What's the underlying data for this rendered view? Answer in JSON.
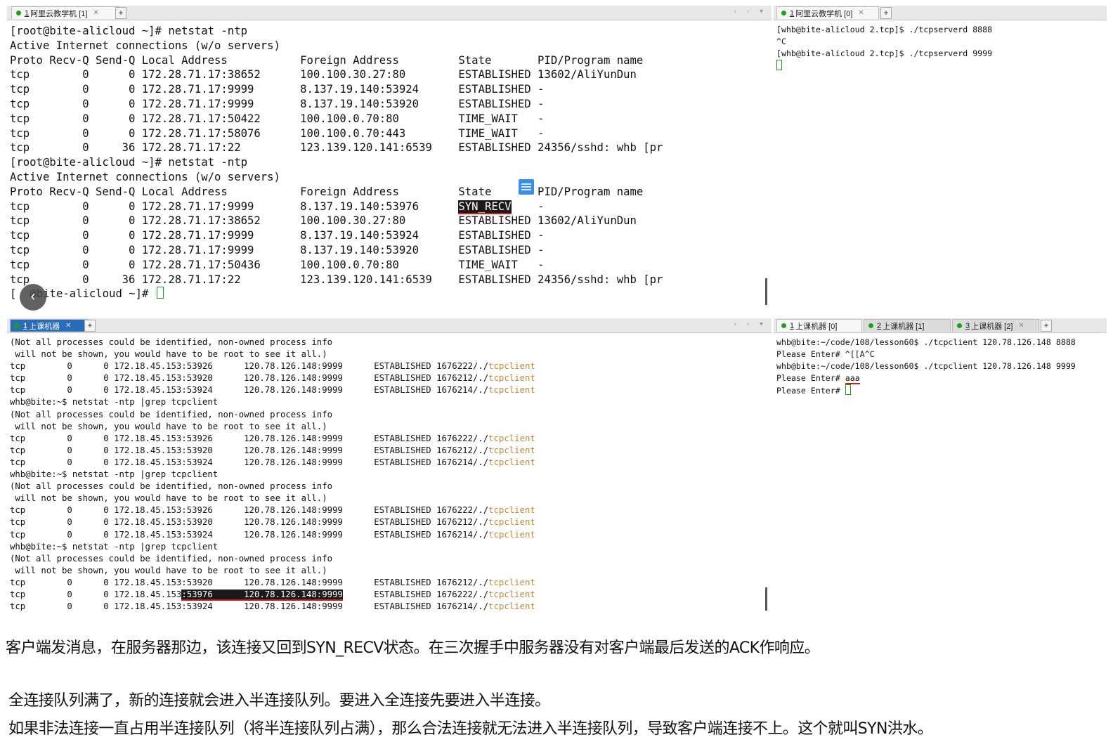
{
  "top_left": {
    "tab": {
      "index": "1",
      "label": "阿里云教学机 [1]"
    },
    "lines": [
      "[root@bite-alicloud ~]# netstat -ntp",
      "Active Internet connections (w/o servers)",
      "Proto Recv-Q Send-Q Local Address           Foreign Address         State       PID/Program name",
      "tcp        0      0 172.28.71.17:38652      100.100.30.27:80        ESTABLISHED 13602/AliYunDun",
      "tcp        0      0 172.28.71.17:9999       8.137.19.140:53924      ESTABLISHED -",
      "tcp        0      0 172.28.71.17:9999       8.137.19.140:53920      ESTABLISHED -",
      "tcp        0      0 172.28.71.17:50422      100.100.0.70:80         TIME_WAIT   -",
      "tcp        0      0 172.28.71.17:58076      100.100.0.70:443        TIME_WAIT   -",
      "tcp        0     36 172.28.71.17:22         123.139.120.141:6539    ESTABLISHED 24356/sshd: whb [pr",
      "[root@bite-alicloud ~]# netstat -ntp",
      "Active Internet connections (w/o servers)",
      "Proto Recv-Q Send-Q Local Address           Foreign Address         State       PID/Program name"
    ],
    "syn_row": {
      "pre": "tcp        0      0 172.28.71.17:9999       8.137.19.140:53976      ",
      "state": "SYN_RECV",
      "post": "    -"
    },
    "lines2": [
      "tcp        0      0 172.28.71.17:38652      100.100.30.27:80        ESTABLISHED 13602/AliYunDun",
      "tcp        0      0 172.28.71.17:9999       8.137.19.140:53924      ESTABLISHED -",
      "tcp        0      0 172.28.71.17:9999       8.137.19.140:53920      ESTABLISHED -",
      "tcp        0      0 172.28.71.17:50436      100.100.0.70:80         TIME_WAIT   -",
      "tcp        0     36 172.28.71.17:22         123.139.120.141:6539    ESTABLISHED 24356/sshd: whb [pr"
    ],
    "prompt_pre": "[",
    "prompt_post": "@bite-alicloud ~]# "
  },
  "top_right": {
    "tab": {
      "index": "1",
      "label": "阿里云教学机 [0]"
    },
    "lines": [
      "[whb@bite-alicloud 2.tcp]$ ./tcpserverd 8888",
      "^C",
      "[whb@bite-alicloud 2.tcp]$ ./tcpserverd 9999"
    ]
  },
  "bottom_left": {
    "tab": {
      "index": "1",
      "label": "上课机器"
    },
    "note1": "(Not all processes could be identified, non-owned process info",
    "note2": " will not be shown, you would have to be root to see it all.)",
    "cmd": "whb@bite:~$ netstat -ntp |grep tcpclient",
    "prog_prefix": "/./",
    "prog": "tcpclient",
    "rows_a": [
      {
        "pre": "tcp        0      0 172.18.45.153:53926      120.78.126.148:9999      ESTABLISHED 1676222"
      },
      {
        "pre": "tcp        0      0 172.18.45.153:53920      120.78.126.148:9999      ESTABLISHED 1676212"
      },
      {
        "pre": "tcp        0      0 172.18.45.153:53924      120.78.126.148:9999      ESTABLISHED 1676214"
      }
    ],
    "last_rows": {
      "r1": "tcp        0      0 172.18.45.153:53920      120.78.126.148:9999      ESTABLISHED 1676212",
      "r2_pre": "tcp        0      0 172.18.45.153",
      "r2_hl": ":53976      120.78.126.148:9999",
      "r2_post": "      ESTABLISHED 1676222",
      "r3": "tcp        0      0 172.18.45.153:53924      120.78.126.148:9999      ESTABLISHED 1676214"
    }
  },
  "bottom_right": {
    "tabs": [
      {
        "index": "1",
        "label": "上课机器 [0]"
      },
      {
        "index": "2",
        "label": "上课机器 [1]"
      },
      {
        "index": "3",
        "label": "上课机器 [2]"
      }
    ],
    "lines": [
      "whb@bite:~/code/108/lesson60$ ./tcpclient 120.78.126.148 8888",
      "Please Enter# ^[[A^C",
      "whb@bite:~/code/108/lesson60$ ./tcpclient 120.78.126.148 9999"
    ],
    "enter_label": "Please Enter# ",
    "typed": "aaa"
  },
  "captions": [
    "客户端发消息，在服务器那边，该连接又回到SYN_RECV状态。在三次握手中服务器没有对客户端最后发送的ACK作响应。",
    "全连接队列满了，新的连接就会进入半连接队列。要进入全连接先要进入半连接。",
    "如果非法连接一直占用半连接队列（将半连接队列占满），那么合法连接就无法进入半连接队列，导致客户端连接不上。这个就叫SYN洪水。"
  ]
}
